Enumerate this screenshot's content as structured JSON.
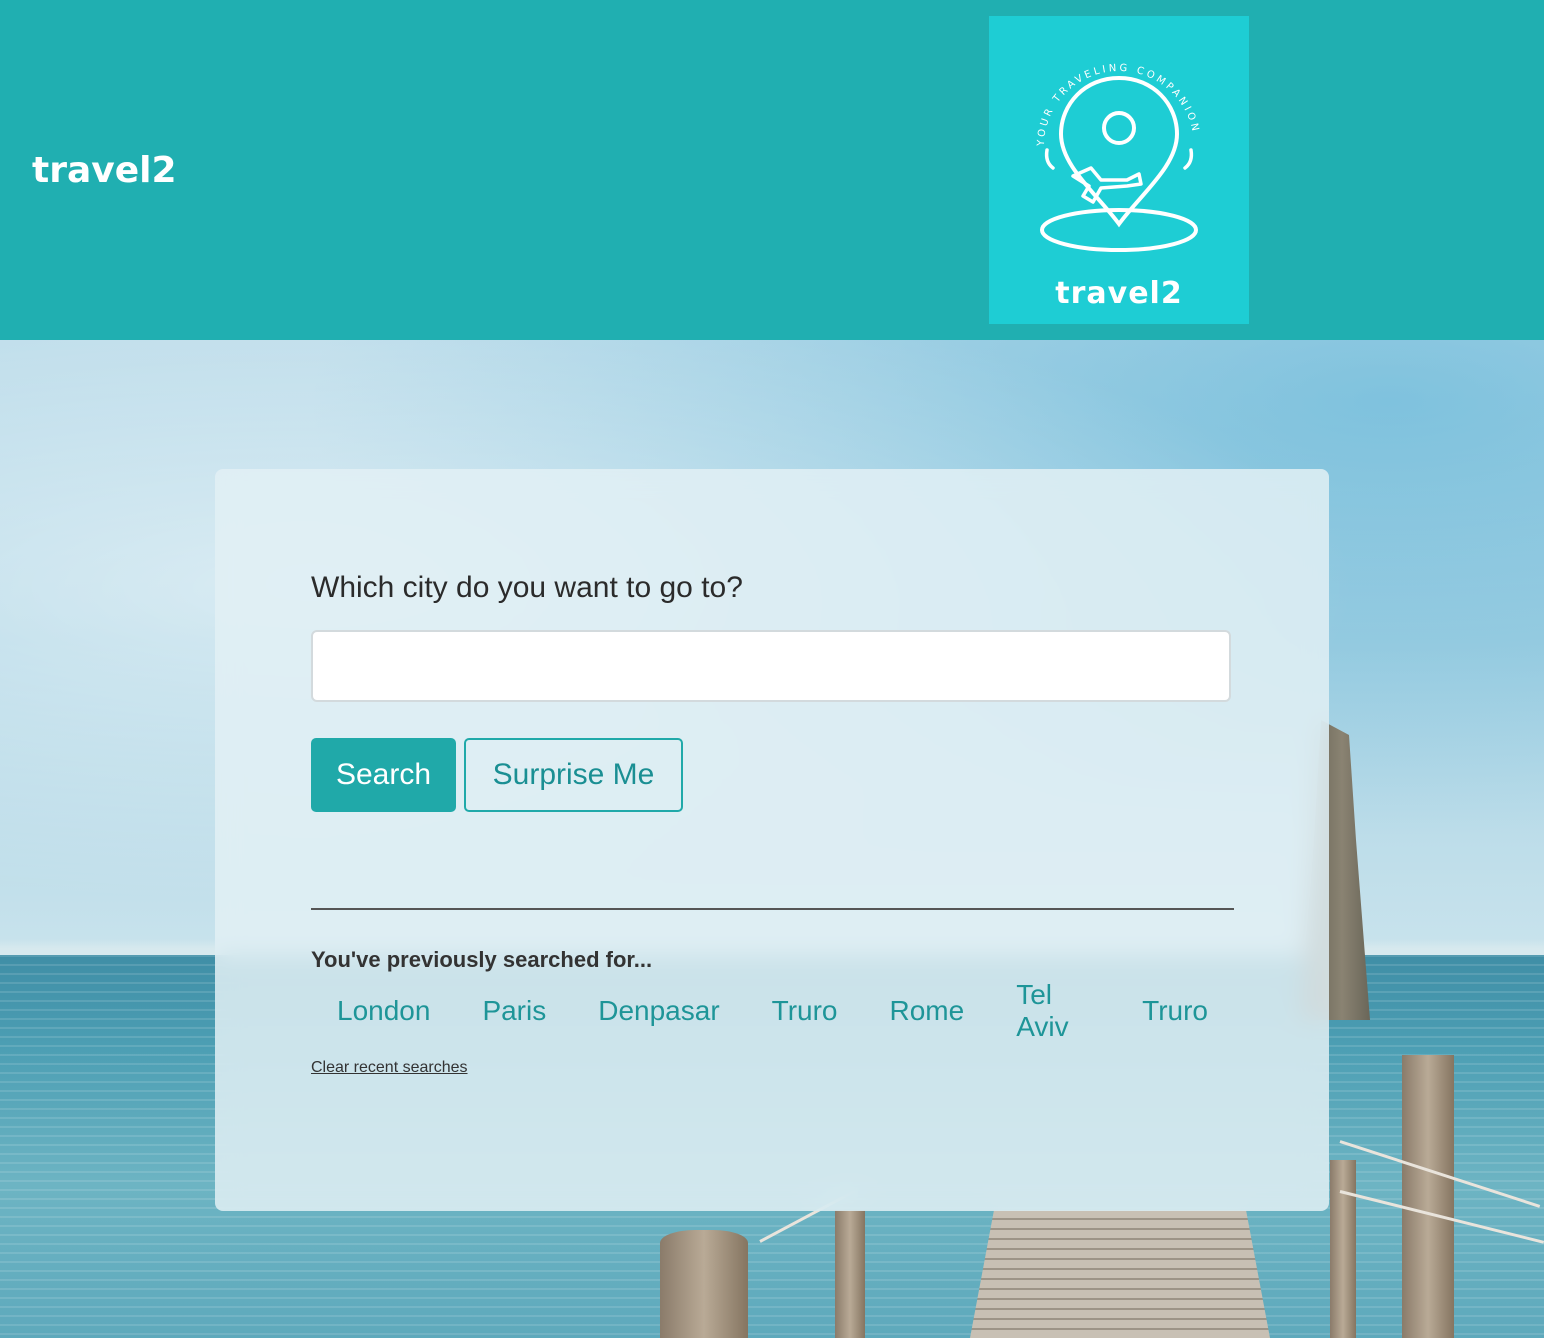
{
  "header": {
    "brand": "travel2",
    "logo": {
      "icon": "map-pin-airplane-logo",
      "tagline": "YOUR TRAVELING COMPANION",
      "wordmark": "travel2"
    }
  },
  "search": {
    "question": "Which city do you want to go to?",
    "input_value": "",
    "search_label": "Search",
    "surprise_label": "Surprise Me"
  },
  "recent": {
    "title": "You've previously searched for...",
    "items": [
      "London",
      "Paris",
      "Denpasar",
      "Truro",
      "Rome",
      "Tel Aviv",
      "Truro"
    ],
    "clear_label": "Clear recent searches"
  },
  "colors": {
    "header_bg": "#20afb1",
    "logo_bg": "#1ecdd4",
    "accent": "#20a9a9",
    "link": "#1e9598"
  }
}
